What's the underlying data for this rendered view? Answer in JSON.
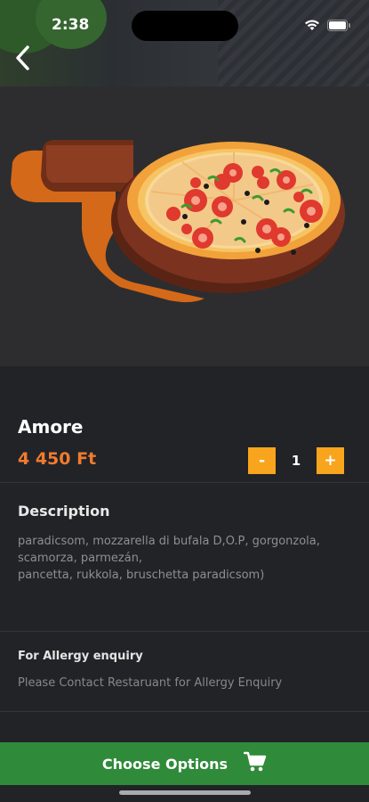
{
  "status_bar": {
    "time": "2:38"
  },
  "product": {
    "name": "Amore",
    "price": "4 450 Ft",
    "quantity": "1",
    "decrement_label": "-",
    "increment_label": "+"
  },
  "description": {
    "title": "Description",
    "lines": [
      "paradicsom, mozzarella di bufala D,O.P, gorgonzola,",
      "scamorza, parmezán,",
      "pancetta, rukkola, bruschetta paradicsom)"
    ]
  },
  "allergy": {
    "title": "For Allergy enquiry",
    "text": "Please Contact Restaruant for Allergy Enquiry"
  },
  "cta": {
    "label": "Choose Options",
    "icon": "cart-icon"
  },
  "colors": {
    "accent_price": "#f07b2e",
    "qty_button": "#f8a51d",
    "cta_green": "#2f8a3a",
    "background": "#222327"
  },
  "icons": [
    "chevron-left-icon",
    "wifi-icon",
    "battery-icon",
    "cart-icon"
  ]
}
